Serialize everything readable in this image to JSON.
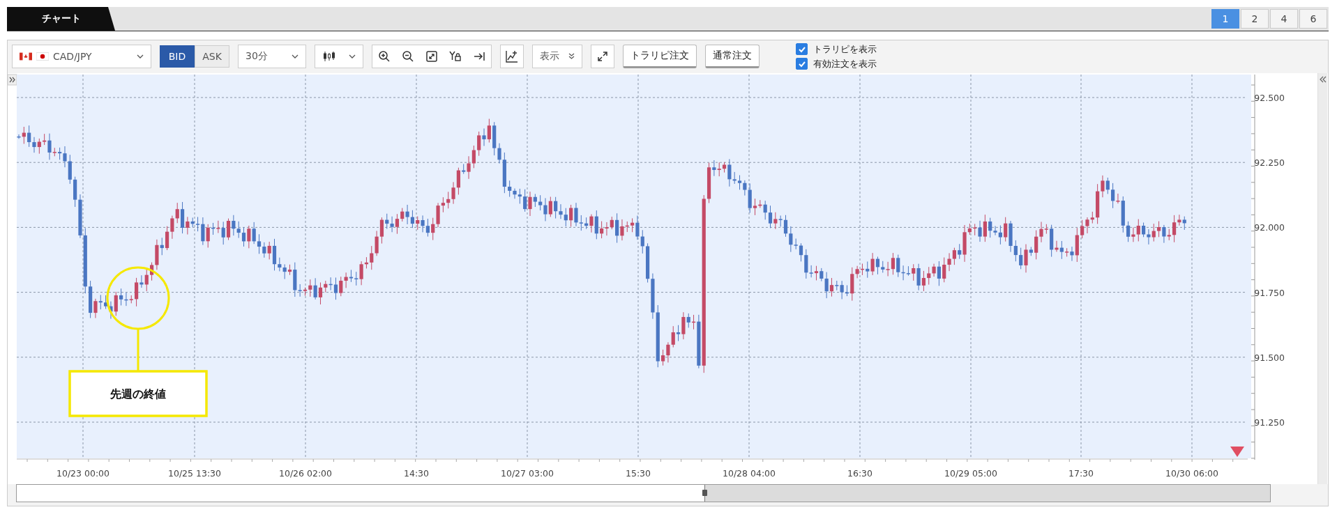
{
  "tab_bar": {
    "tabs": [
      {
        "label": "チャート",
        "selected": true
      }
    ],
    "layouts": [
      {
        "label": "1",
        "selected": true
      },
      {
        "label": "2",
        "selected": false
      },
      {
        "label": "4",
        "selected": false
      },
      {
        "label": "6",
        "selected": false
      }
    ]
  },
  "toolbar": {
    "symbol": "CAD/JPY",
    "price_side": [
      {
        "label": "BID",
        "selected": true
      },
      {
        "label": "ASK",
        "selected": false
      }
    ],
    "timeframe": "30分",
    "display_menu": "表示",
    "order_buttons": [
      "トラリピ注文",
      "通常注文"
    ],
    "checkboxes": [
      {
        "label": "トラリピを表示",
        "checked": true
      },
      {
        "label": "有効注文を表示",
        "checked": true
      }
    ]
  },
  "chart": {
    "y_axis_labels": [
      "92.500",
      "92.250",
      "92.000",
      "91.750",
      "91.500",
      "91.250"
    ],
    "x_axis_labels": [
      "10/23 00:00",
      "10/25 13:30",
      "10/26 02:00",
      "14:30",
      "10/27 03:00",
      "15:30",
      "10/28 04:00",
      "16:30",
      "10/29 05:00",
      "17:30",
      "10/30 06:00"
    ],
    "annotation": "先週の終値"
  }
}
